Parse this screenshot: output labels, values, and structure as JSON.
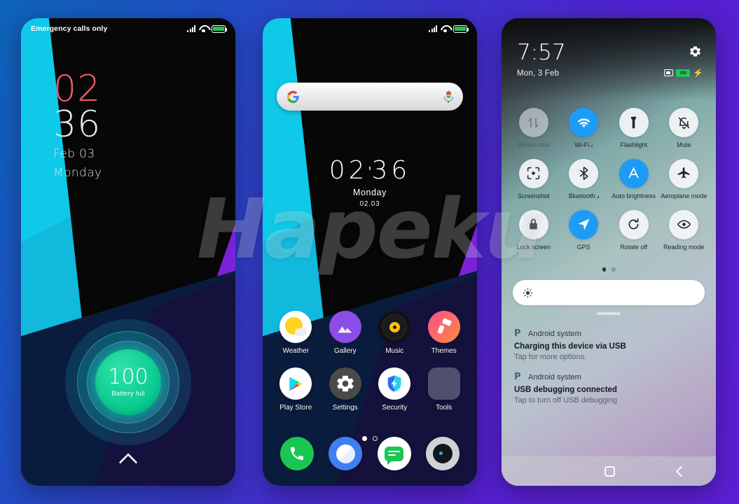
{
  "background": {
    "from": "#0d63b8",
    "to": "#5b1fd2"
  },
  "watermark": {
    "text": "Hapeku"
  },
  "lock_screen": {
    "status_bar": {
      "carrier": "Emergency calls only",
      "signal_icon": "signal-bars-icon",
      "wifi_icon": "wifi-icon",
      "battery_icon": "battery-icon"
    },
    "clock": {
      "hours": "02",
      "minutes": "36",
      "date": "Feb 03",
      "weekday": "Monday",
      "hours_color": "#f2596c",
      "minutes_color": "#e6e8ea"
    },
    "battery_widget": {
      "percent": "100",
      "label": "Battery full",
      "accent": "#07c98f"
    },
    "unlock_hint_icon": "chevron-up-icon"
  },
  "home_screen": {
    "status_bar": {
      "carrier": "",
      "signal_icon": "signal-bars-icon",
      "wifi_icon": "wifi-icon",
      "battery_icon": "battery-icon"
    },
    "search": {
      "logo_icon": "google-logo-icon",
      "placeholder": "",
      "mic_icon": "microphone-icon"
    },
    "clock": {
      "hours": "02",
      "separator": "'",
      "minutes": "36",
      "weekday": "Monday",
      "date": "02.03"
    },
    "apps": [
      {
        "label": "Weather",
        "icon": "weather-icon"
      },
      {
        "label": "Gallery",
        "icon": "gallery-icon"
      },
      {
        "label": "Music",
        "icon": "music-icon"
      },
      {
        "label": "Themes",
        "icon": "themes-icon"
      },
      {
        "label": "Play Store",
        "icon": "play-store-icon"
      },
      {
        "label": "Settings",
        "icon": "settings-icon"
      },
      {
        "label": "Security",
        "icon": "security-icon"
      },
      {
        "label": "Tools",
        "icon": "tools-folder-icon"
      }
    ],
    "page_dots": {
      "count": 2,
      "active": 0
    },
    "dock": [
      {
        "label": "Phone",
        "icon": "phone-icon"
      },
      {
        "label": "Browser",
        "icon": "browser-icon"
      },
      {
        "label": "Messages",
        "icon": "messages-icon"
      },
      {
        "label": "Camera",
        "icon": "camera-icon"
      }
    ]
  },
  "notification_panel": {
    "time": "7:57",
    "date": "Mon, 3 Feb",
    "settings_icon": "gear-icon",
    "status": {
      "cast_icon": "cast-icon",
      "battery_level": "100",
      "charging_icon": "bolt-icon"
    },
    "tiles": [
      {
        "label": "Mobile data",
        "icon": "mobile-data-icon",
        "state": "dim",
        "caret": false
      },
      {
        "label": "Wi-Fi",
        "icon": "wifi-icon",
        "state": "active",
        "caret": true
      },
      {
        "label": "Flashlight",
        "icon": "flashlight-icon",
        "state": "off",
        "caret": false
      },
      {
        "label": "Mute",
        "icon": "bell-muted-icon",
        "state": "off",
        "caret": false
      },
      {
        "label": "Screenshot",
        "icon": "screenshot-icon",
        "state": "off",
        "caret": false
      },
      {
        "label": "Bluetooth",
        "icon": "bluetooth-icon",
        "state": "off",
        "caret": true
      },
      {
        "label": "Auto brightness",
        "icon": "auto-brightness-icon",
        "state": "active",
        "caret": false
      },
      {
        "label": "Aeroplane mode",
        "icon": "aeroplane-icon",
        "state": "off",
        "caret": false
      },
      {
        "label": "Lock screen",
        "icon": "lock-icon",
        "state": "off",
        "caret": false
      },
      {
        "label": "GPS",
        "icon": "location-arrow-icon",
        "state": "active",
        "caret": false
      },
      {
        "label": "Rotate off",
        "icon": "rotate-icon",
        "state": "off",
        "caret": false
      },
      {
        "label": "Reading mode",
        "icon": "eye-icon",
        "state": "off",
        "caret": false
      }
    ],
    "qs_page_dots": {
      "count": 2,
      "active": 0
    },
    "brightness": {
      "icon": "brightness-icon",
      "value": ""
    },
    "notifications": [
      {
        "app": "Android system",
        "app_icon": "android-p-icon",
        "title": "Charging this device via USB",
        "subtitle": "Tap for more options."
      },
      {
        "app": "Android system",
        "app_icon": "android-p-icon",
        "title": "USB debugging connected",
        "subtitle": "Tap to turn off USB debugging"
      }
    ],
    "nav_bar": [
      {
        "icon": "recents-icon"
      },
      {
        "icon": "home-icon"
      },
      {
        "icon": "back-icon"
      }
    ]
  }
}
